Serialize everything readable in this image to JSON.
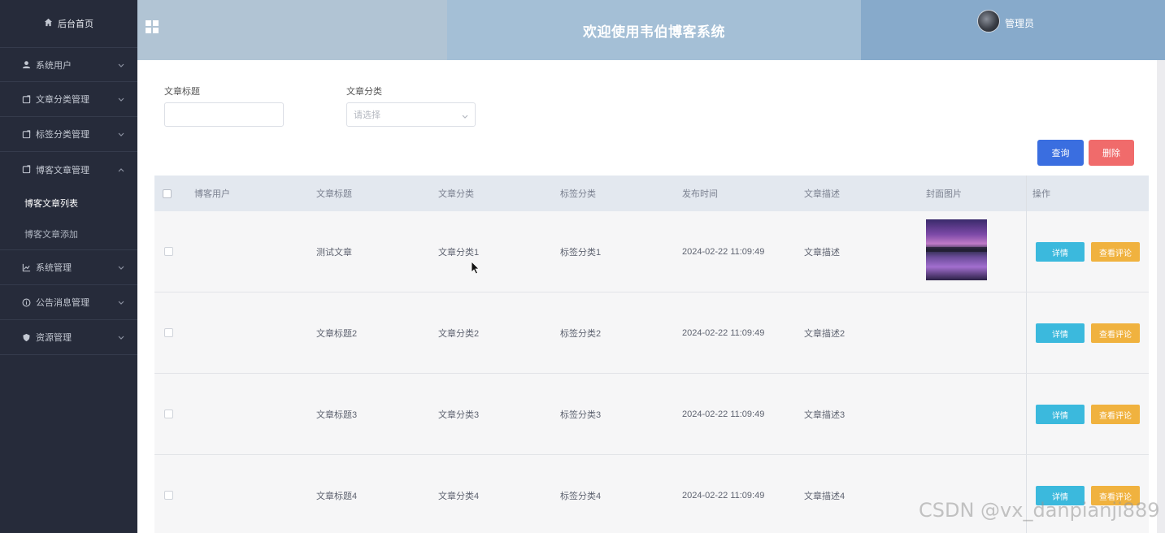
{
  "sidebar": {
    "home": "后台首页",
    "items": [
      {
        "label": "系统用户",
        "icon": "user-icon"
      },
      {
        "label": "文章分类管理",
        "icon": "folder-icon"
      },
      {
        "label": "标签分类管理",
        "icon": "folder-icon"
      },
      {
        "label": "博客文章管理",
        "icon": "folder-icon",
        "expanded": true
      }
    ],
    "subitems": [
      "博客文章列表",
      "博客文章添加"
    ],
    "items_after": [
      {
        "label": "系统管理",
        "icon": "chart-icon"
      },
      {
        "label": "公告消息管理",
        "icon": "info-icon"
      },
      {
        "label": "资源管理",
        "icon": "shield-icon"
      }
    ]
  },
  "header": {
    "title": "欢迎使用韦伯博客系统",
    "user": "管理员"
  },
  "filters": {
    "title_label": "文章标题",
    "title_value": "",
    "category_label": "文章分类",
    "category_placeholder": "请选择"
  },
  "actions": {
    "query": "查询",
    "delete": "删除"
  },
  "table": {
    "columns": [
      "博客用户",
      "文章标题",
      "文章分类",
      "标签分类",
      "发布时间",
      "文章描述",
      "封面图片",
      "操作"
    ],
    "rows": [
      {
        "user": "",
        "title": "测试文章",
        "category": "文章分类1",
        "tag": "标签分类1",
        "time": "2024-02-22 11:09:49",
        "desc": "文章描述",
        "has_cover": true
      },
      {
        "user": "",
        "title": "文章标题2",
        "category": "文章分类2",
        "tag": "标签分类2",
        "time": "2024-02-22 11:09:49",
        "desc": "文章描述2",
        "has_cover": false
      },
      {
        "user": "",
        "title": "文章标题3",
        "category": "文章分类3",
        "tag": "标签分类3",
        "time": "2024-02-22 11:09:49",
        "desc": "文章描述3",
        "has_cover": false
      },
      {
        "user": "",
        "title": "文章标题4",
        "category": "文章分类4",
        "tag": "标签分类4",
        "time": "2024-02-22 11:09:49",
        "desc": "文章描述4",
        "has_cover": false
      }
    ],
    "detail_label": "详情",
    "comment_label": "查看评论"
  },
  "watermark": "CSDN @vx_danpianji889",
  "colors": {
    "sidebar_bg": "#262b3a",
    "primary": "#3a6ee0",
    "danger": "#f06b6b",
    "info": "#3bb9dd",
    "warning": "#f0b23f"
  }
}
